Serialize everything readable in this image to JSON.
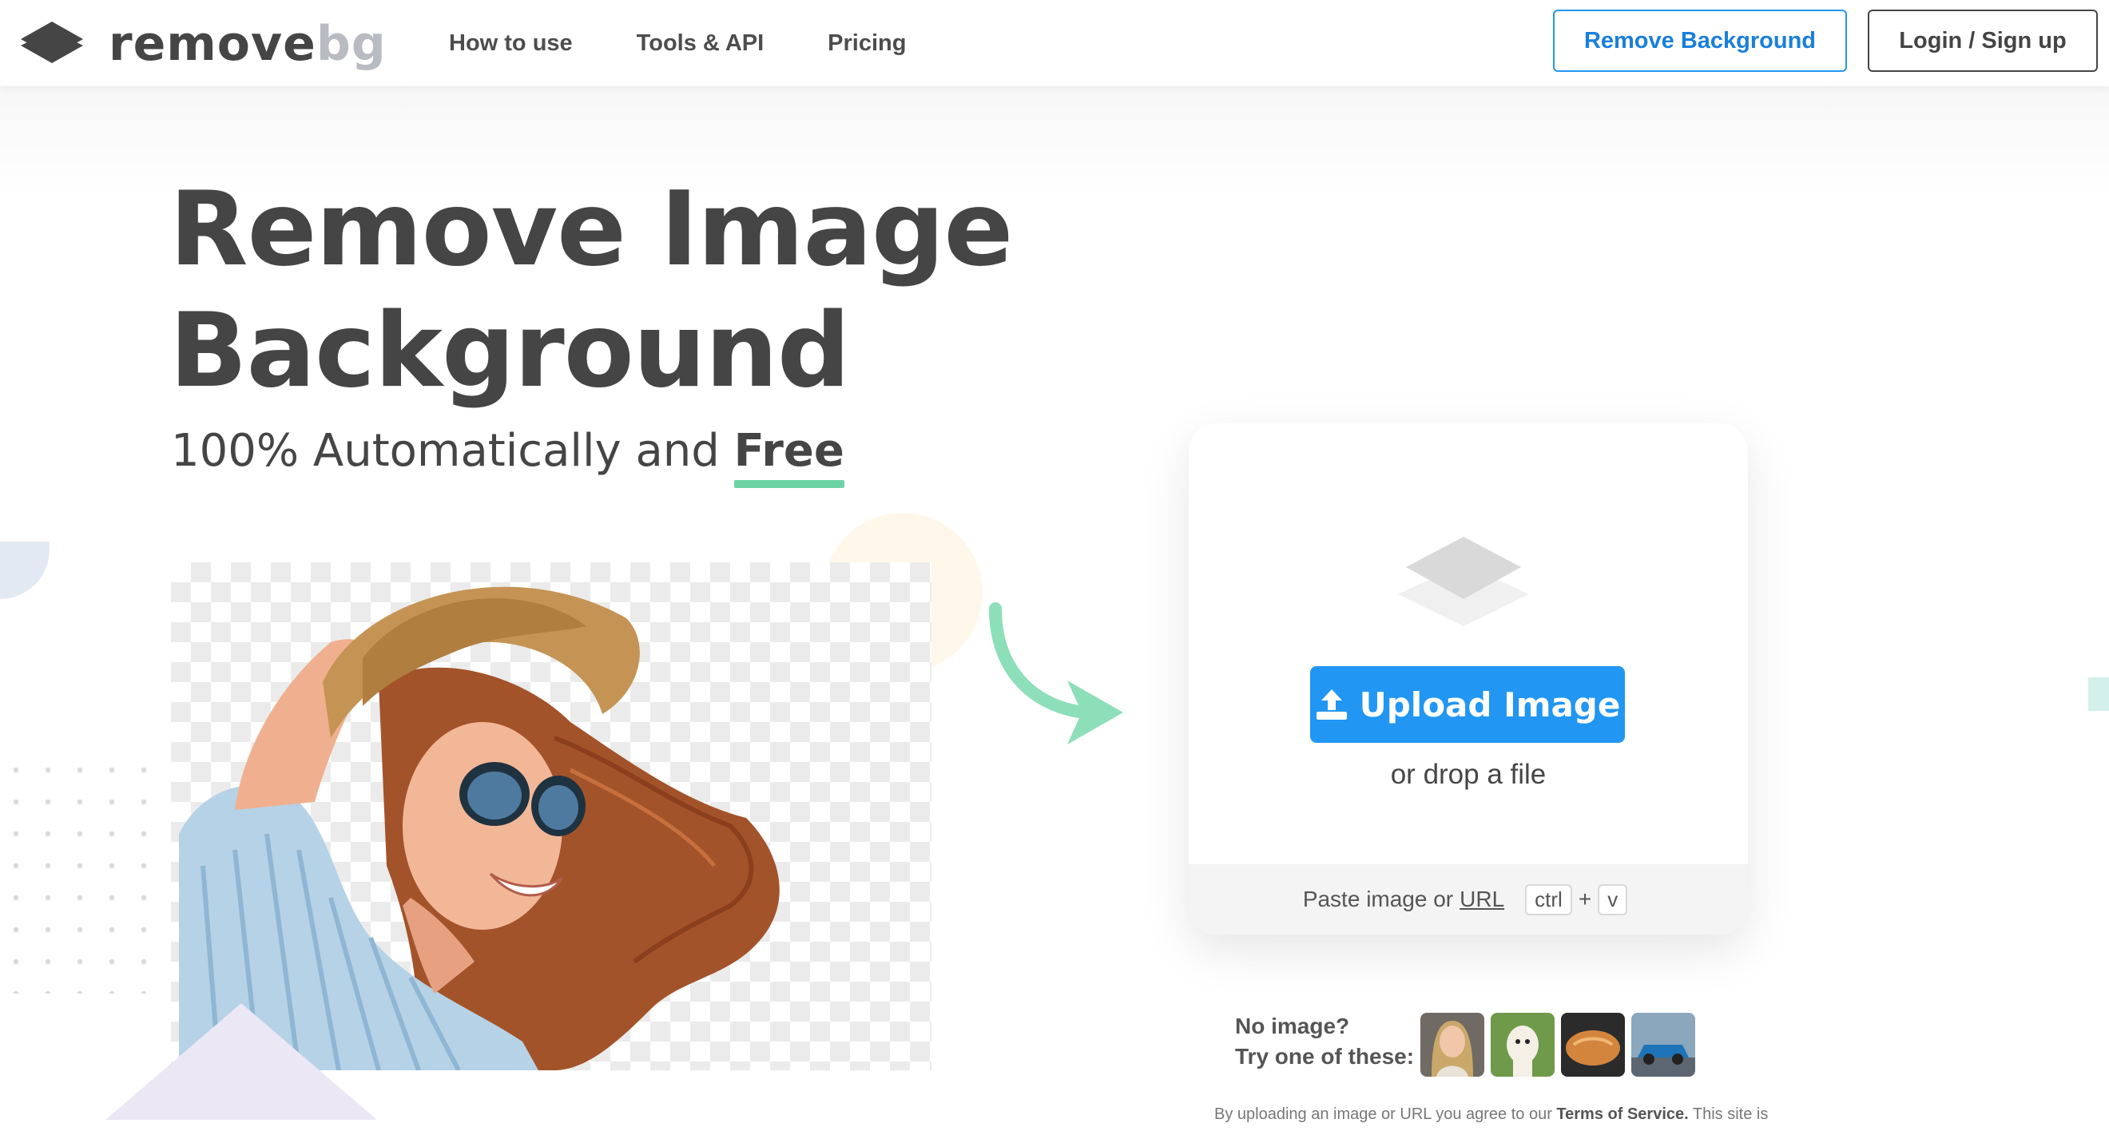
{
  "header": {
    "logo": {
      "part1": "remove",
      "part2": "bg"
    },
    "nav": [
      "How to use",
      "Tools & API",
      "Pricing"
    ],
    "remove_background_label": "Remove Background",
    "login_label": "Login / Sign up"
  },
  "hero": {
    "title_line1": "Remove Image",
    "title_line2": "Background",
    "subtitle_prefix": "100% Automatically and ",
    "subtitle_emphasis": "Free"
  },
  "upload": {
    "button_label": "Upload Image",
    "drop_text": "or drop a file",
    "paste_text": "Paste image or",
    "url_link": "URL",
    "key_ctrl": "ctrl",
    "key_plus": "+",
    "key_v": "v"
  },
  "samples": {
    "line1": "No image?",
    "line2": "Try one of these:"
  },
  "terms": {
    "prefix": "By uploading an image or URL you agree to our",
    "link": "Terms of Service.",
    "suffix": "This site is"
  },
  "colors": {
    "accent_blue": "#2196f3",
    "text_dark": "#454545",
    "green": "#6cd4a5"
  }
}
